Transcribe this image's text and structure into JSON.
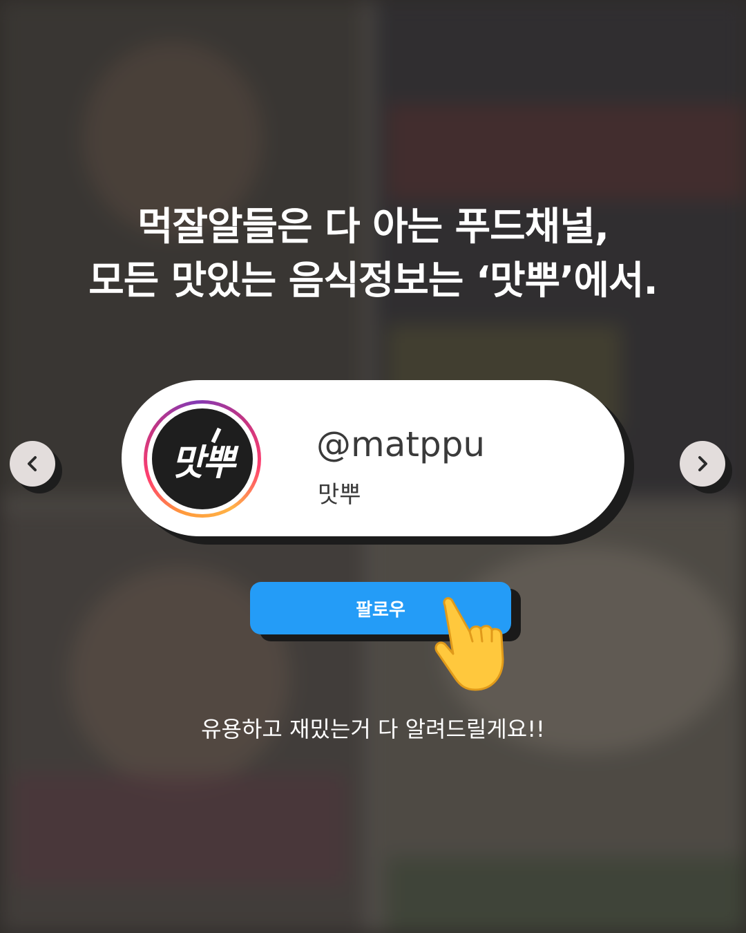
{
  "headline": {
    "line1": "먹잘알들은 다 아는 푸드채널,",
    "line2": "모든 맛있는 음식정보는 ‘맛뿌’에서."
  },
  "profile": {
    "handle": "@matppu",
    "name": "맛뿌",
    "avatar_text": "맛뿌"
  },
  "follow_button": {
    "label": "팔로우"
  },
  "caption": "유용하고 재밌는거 다 알려드릴게요!!",
  "icons": {
    "prev": "chevron-left-icon",
    "next": "chevron-right-icon",
    "pointer": "pointing-hand-icon"
  },
  "colors": {
    "follow_button": "#249cf7",
    "card": "#ffffff",
    "avatar_bg": "#1e1e1e",
    "text_dark": "#3a3a3a"
  }
}
